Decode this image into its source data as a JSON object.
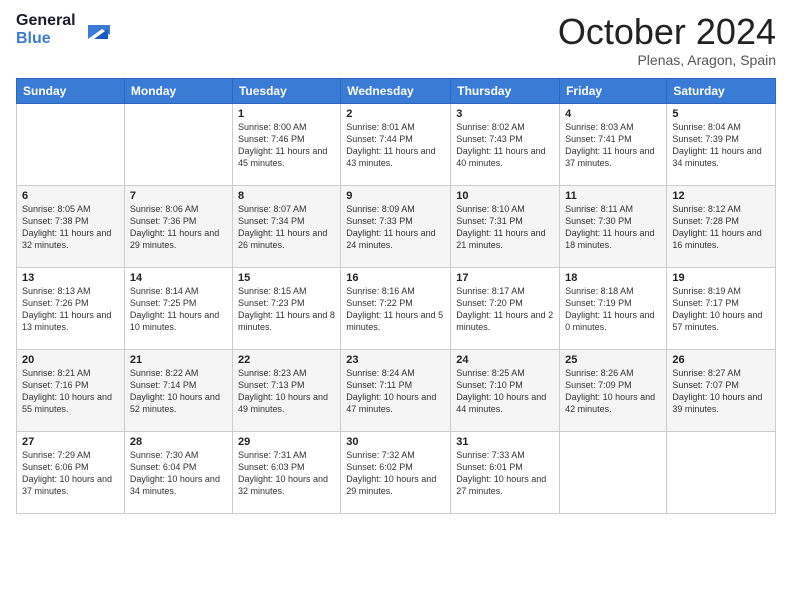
{
  "logo": {
    "line1": "General",
    "line2": "Blue"
  },
  "title": "October 2024",
  "location": "Plenas, Aragon, Spain",
  "days_header": [
    "Sunday",
    "Monday",
    "Tuesday",
    "Wednesday",
    "Thursday",
    "Friday",
    "Saturday"
  ],
  "weeks": [
    [
      {
        "day": "",
        "info": ""
      },
      {
        "day": "",
        "info": ""
      },
      {
        "day": "1",
        "info": "Sunrise: 8:00 AM\nSunset: 7:46 PM\nDaylight: 11 hours and 45 minutes."
      },
      {
        "day": "2",
        "info": "Sunrise: 8:01 AM\nSunset: 7:44 PM\nDaylight: 11 hours and 43 minutes."
      },
      {
        "day": "3",
        "info": "Sunrise: 8:02 AM\nSunset: 7:43 PM\nDaylight: 11 hours and 40 minutes."
      },
      {
        "day": "4",
        "info": "Sunrise: 8:03 AM\nSunset: 7:41 PM\nDaylight: 11 hours and 37 minutes."
      },
      {
        "day": "5",
        "info": "Sunrise: 8:04 AM\nSunset: 7:39 PM\nDaylight: 11 hours and 34 minutes."
      }
    ],
    [
      {
        "day": "6",
        "info": "Sunrise: 8:05 AM\nSunset: 7:38 PM\nDaylight: 11 hours and 32 minutes."
      },
      {
        "day": "7",
        "info": "Sunrise: 8:06 AM\nSunset: 7:36 PM\nDaylight: 11 hours and 29 minutes."
      },
      {
        "day": "8",
        "info": "Sunrise: 8:07 AM\nSunset: 7:34 PM\nDaylight: 11 hours and 26 minutes."
      },
      {
        "day": "9",
        "info": "Sunrise: 8:09 AM\nSunset: 7:33 PM\nDaylight: 11 hours and 24 minutes."
      },
      {
        "day": "10",
        "info": "Sunrise: 8:10 AM\nSunset: 7:31 PM\nDaylight: 11 hours and 21 minutes."
      },
      {
        "day": "11",
        "info": "Sunrise: 8:11 AM\nSunset: 7:30 PM\nDaylight: 11 hours and 18 minutes."
      },
      {
        "day": "12",
        "info": "Sunrise: 8:12 AM\nSunset: 7:28 PM\nDaylight: 11 hours and 16 minutes."
      }
    ],
    [
      {
        "day": "13",
        "info": "Sunrise: 8:13 AM\nSunset: 7:26 PM\nDaylight: 11 hours and 13 minutes."
      },
      {
        "day": "14",
        "info": "Sunrise: 8:14 AM\nSunset: 7:25 PM\nDaylight: 11 hours and 10 minutes."
      },
      {
        "day": "15",
        "info": "Sunrise: 8:15 AM\nSunset: 7:23 PM\nDaylight: 11 hours and 8 minutes."
      },
      {
        "day": "16",
        "info": "Sunrise: 8:16 AM\nSunset: 7:22 PM\nDaylight: 11 hours and 5 minutes."
      },
      {
        "day": "17",
        "info": "Sunrise: 8:17 AM\nSunset: 7:20 PM\nDaylight: 11 hours and 2 minutes."
      },
      {
        "day": "18",
        "info": "Sunrise: 8:18 AM\nSunset: 7:19 PM\nDaylight: 11 hours and 0 minutes."
      },
      {
        "day": "19",
        "info": "Sunrise: 8:19 AM\nSunset: 7:17 PM\nDaylight: 10 hours and 57 minutes."
      }
    ],
    [
      {
        "day": "20",
        "info": "Sunrise: 8:21 AM\nSunset: 7:16 PM\nDaylight: 10 hours and 55 minutes."
      },
      {
        "day": "21",
        "info": "Sunrise: 8:22 AM\nSunset: 7:14 PM\nDaylight: 10 hours and 52 minutes."
      },
      {
        "day": "22",
        "info": "Sunrise: 8:23 AM\nSunset: 7:13 PM\nDaylight: 10 hours and 49 minutes."
      },
      {
        "day": "23",
        "info": "Sunrise: 8:24 AM\nSunset: 7:11 PM\nDaylight: 10 hours and 47 minutes."
      },
      {
        "day": "24",
        "info": "Sunrise: 8:25 AM\nSunset: 7:10 PM\nDaylight: 10 hours and 44 minutes."
      },
      {
        "day": "25",
        "info": "Sunrise: 8:26 AM\nSunset: 7:09 PM\nDaylight: 10 hours and 42 minutes."
      },
      {
        "day": "26",
        "info": "Sunrise: 8:27 AM\nSunset: 7:07 PM\nDaylight: 10 hours and 39 minutes."
      }
    ],
    [
      {
        "day": "27",
        "info": "Sunrise: 7:29 AM\nSunset: 6:06 PM\nDaylight: 10 hours and 37 minutes."
      },
      {
        "day": "28",
        "info": "Sunrise: 7:30 AM\nSunset: 6:04 PM\nDaylight: 10 hours and 34 minutes."
      },
      {
        "day": "29",
        "info": "Sunrise: 7:31 AM\nSunset: 6:03 PM\nDaylight: 10 hours and 32 minutes."
      },
      {
        "day": "30",
        "info": "Sunrise: 7:32 AM\nSunset: 6:02 PM\nDaylight: 10 hours and 29 minutes."
      },
      {
        "day": "31",
        "info": "Sunrise: 7:33 AM\nSunset: 6:01 PM\nDaylight: 10 hours and 27 minutes."
      },
      {
        "day": "",
        "info": ""
      },
      {
        "day": "",
        "info": ""
      }
    ]
  ]
}
